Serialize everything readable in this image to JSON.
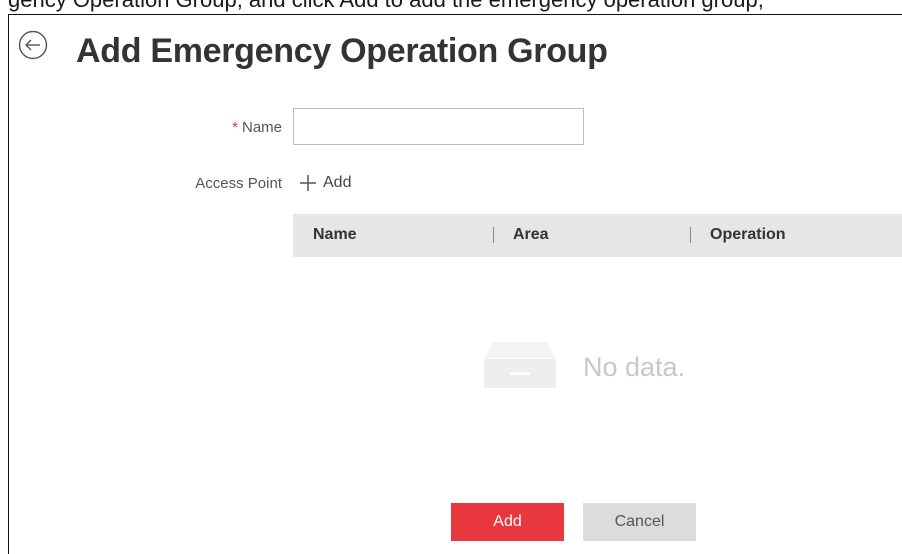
{
  "caption": "gency Operation Group, and click Add to add the emergency operation group,",
  "page": {
    "title": "Add Emergency Operation Group"
  },
  "form": {
    "name_required_mark": "*",
    "name_label": "Name",
    "name_value": "",
    "access_point_label": "Access Point",
    "access_point_add_label": "Add"
  },
  "table": {
    "columns": [
      "Name",
      "Area",
      "Operation"
    ],
    "rows": [],
    "empty_text": "No data."
  },
  "actions": {
    "add_label": "Add",
    "cancel_label": "Cancel"
  },
  "colors": {
    "primary": "#e8383d",
    "header_bg": "#e6e6e6",
    "cancel_bg": "#dcdcdc",
    "empty_text": "#c8c8c8"
  }
}
